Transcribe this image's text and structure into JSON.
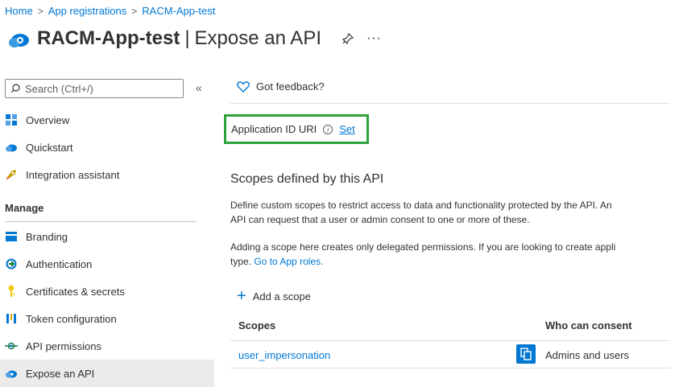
{
  "breadcrumb": {
    "home": "Home",
    "app_registrations": "App registrations",
    "current": "RACM-App-test"
  },
  "header": {
    "app_name": "RACM-App-test",
    "divider": "|",
    "page_title": "Expose an API",
    "more": "···"
  },
  "sidebar": {
    "search_placeholder": "Search (Ctrl+/)",
    "collapse": "«",
    "top_items": [
      {
        "label": "Overview",
        "icon": "overview-icon"
      },
      {
        "label": "Quickstart",
        "icon": "quickstart-icon"
      },
      {
        "label": "Integration assistant",
        "icon": "rocket-icon"
      }
    ],
    "manage_heading": "Manage",
    "manage_items": [
      {
        "label": "Branding",
        "icon": "branding-icon"
      },
      {
        "label": "Authentication",
        "icon": "authentication-icon"
      },
      {
        "label": "Certificates & secrets",
        "icon": "key-icon"
      },
      {
        "label": "Token configuration",
        "icon": "token-icon"
      },
      {
        "label": "API permissions",
        "icon": "api-permissions-icon"
      },
      {
        "label": "Expose an API",
        "icon": "cloud-icon",
        "active": true
      }
    ]
  },
  "main": {
    "feedback": "Got feedback?",
    "app_id_uri_label": "Application ID URI",
    "info_glyph": "i",
    "set_link": "Set",
    "scopes_title": "Scopes defined by this API",
    "para1_line1": "Define custom scopes to restrict access to data and functionality protected by the API. An",
    "para1_line2": "API can request that a user or admin consent to one or more of these.",
    "para2_line1": "Adding a scope here creates only delegated permissions. If you are looking to create appli",
    "para2_line2_prefix": "type.",
    "para2_link": "Go to App roles.",
    "add_scope": "Add a scope",
    "plus": "+",
    "table": {
      "col_scopes": "Scopes",
      "col_consent": "Who can consent",
      "rows": [
        {
          "scope": "user_impersonation",
          "consent": "Admins and users"
        }
      ]
    }
  },
  "colors": {
    "accent": "#0078d4",
    "highlight_border": "#2ea23b",
    "active_bg": "#edebe9"
  }
}
